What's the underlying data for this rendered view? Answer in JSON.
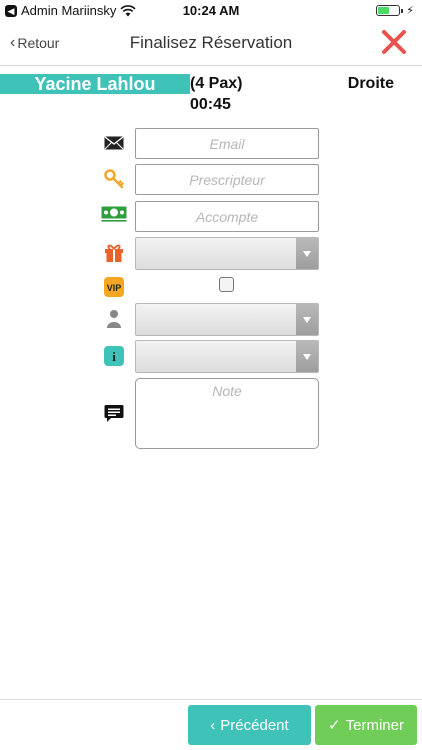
{
  "status_bar": {
    "carrier": "Admin Mariinsky",
    "time": "10:24 AM",
    "battery_level": 0.55
  },
  "nav": {
    "back_label": "Retour",
    "title": "Finalisez Réservation"
  },
  "reservation": {
    "guest_name": "Yacine Lahlou",
    "pax": "(4 Pax)",
    "time": "00:45",
    "side": "Droite"
  },
  "form": {
    "email": {
      "placeholder": "Email",
      "value": ""
    },
    "prescripteur": {
      "placeholder": "Prescripteur",
      "value": ""
    },
    "acompte": {
      "placeholder": "Accompte",
      "value": ""
    },
    "gift_select": {
      "value": ""
    },
    "vip_checked": false,
    "person_select": {
      "value": ""
    },
    "info_select": {
      "value": ""
    },
    "note": {
      "placeholder": "Note",
      "value": ""
    }
  },
  "footer": {
    "prev_label": "Précédent",
    "finish_label": "Terminer"
  },
  "colors": {
    "accent_teal": "#3fc3b8",
    "accent_green": "#6fcd58",
    "close_red": "#e9534f"
  },
  "icons": {
    "email": "envelope-icon",
    "prescripteur": "key-icon",
    "acompte": "money-icon",
    "gift": "gift-icon",
    "vip": "vip-badge-icon",
    "person": "person-icon",
    "info": "info-icon",
    "note": "chat-bubble-icon"
  }
}
